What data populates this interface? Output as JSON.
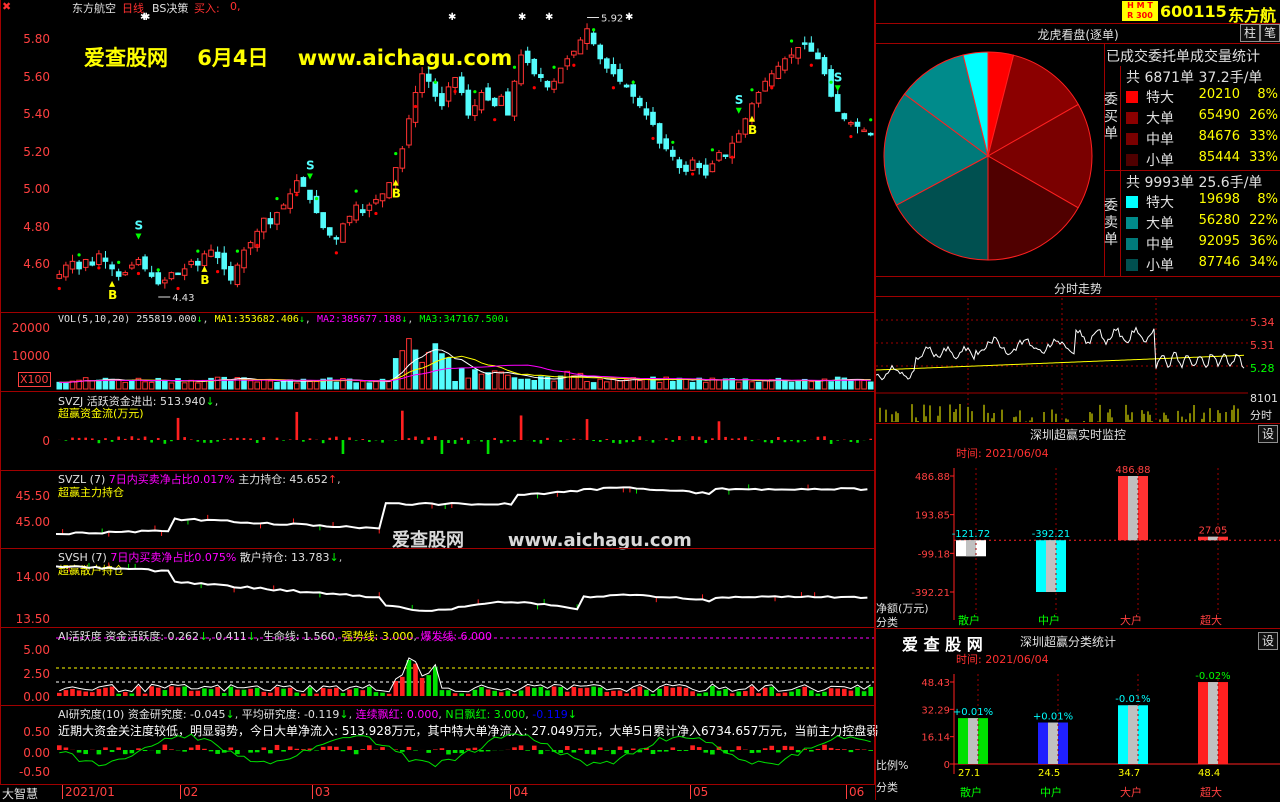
{
  "header": {
    "stock_name": "东方航空",
    "period": "日线",
    "indicator": "BS决策",
    "signal_label": "买入:",
    "signal_value": "0,",
    "hmt": "H M T",
    "r300": "R 300",
    "code": "600115",
    "name_short": "东方航",
    "btn_zhu": "柱",
    "btn_bi": "笔"
  },
  "watermark": {
    "line1": "爱查股网    6月4日    www.aichagu.com",
    "line2": "爱查股网       www.aichagu.com"
  },
  "main_chart": {
    "y_ticks": [
      "5.80",
      "5.60",
      "5.40",
      "5.20",
      "5.00",
      "4.80",
      "4.60"
    ],
    "y_values": [
      5.8,
      5.6,
      5.4,
      5.2,
      5.0,
      4.8,
      4.6
    ],
    "y_range": [
      4.35,
      5.96
    ],
    "high_label": "5.92",
    "low_label": "4.43",
    "closes": [
      4.55,
      4.6,
      4.62,
      4.58,
      4.63,
      4.6,
      4.66,
      4.62,
      4.58,
      4.54,
      4.56,
      4.6,
      4.63,
      4.58,
      4.54,
      4.5,
      4.52,
      4.56,
      4.55,
      4.58,
      4.62,
      4.6,
      4.66,
      4.68,
      4.64,
      4.58,
      4.52,
      4.6,
      4.68,
      4.72,
      4.78,
      4.85,
      4.82,
      4.88,
      4.92,
      4.98,
      5.05,
      5.02,
      4.95,
      4.88,
      4.8,
      4.76,
      4.74,
      4.82,
      4.86,
      4.92,
      4.88,
      4.92,
      4.95,
      4.98,
      5.04,
      5.12,
      5.22,
      5.38,
      5.52,
      5.62,
      5.58,
      5.5,
      5.45,
      5.55,
      5.6,
      5.52,
      5.4,
      5.45,
      5.52,
      5.48,
      5.45,
      5.5,
      5.4,
      5.58,
      5.72,
      5.68,
      5.62,
      5.6,
      5.55,
      5.58,
      5.65,
      5.7,
      5.74,
      5.8,
      5.86,
      5.78,
      5.7,
      5.65,
      5.62,
      5.58,
      5.55,
      5.5,
      5.45,
      5.4,
      5.35,
      5.25,
      5.22,
      5.18,
      5.12,
      5.1,
      5.16,
      5.12,
      5.08,
      5.14,
      5.2,
      5.18,
      5.25,
      5.3,
      5.38,
      5.46,
      5.52,
      5.58,
      5.62,
      5.66,
      5.7,
      5.72,
      5.76,
      5.78,
      5.74,
      5.7,
      5.62,
      5.5,
      5.42,
      5.38,
      5.36,
      5.34,
      5.32,
      5.3
    ],
    "b_signals": [
      "B",
      "B",
      "B",
      "B"
    ],
    "s_signals": [
      "S",
      "S",
      "S",
      "S"
    ],
    "b_index": [
      8,
      22,
      51,
      105
    ],
    "s_index": [
      12,
      38,
      103,
      118
    ]
  },
  "vol_panel": {
    "title": "VOL(5,10,20)",
    "v0": "255819.000",
    "ma1_label": "MA1:",
    "ma1": "353682.406",
    "ma2_label": "MA2:",
    "ma2": "385677.188",
    "ma3_label": "MA3:",
    "ma3": "347167.500",
    "y_ticks": [
      "20000",
      "10000"
    ],
    "unit": "X100"
  },
  "svzj_panel": {
    "title": "SVZJ",
    "line1": "活跃资金进出: 513.940",
    "line2": "超赢资金流(万元)",
    "y_tick": "0"
  },
  "svzl_panel": {
    "title": "SVZL (7)",
    "ratio_label": "7日内买卖净占比0.017%",
    "main_hold": "主力持仓: 45.652",
    "line2": "超赢主力持仓",
    "y_ticks": [
      "45.50",
      "45.00"
    ]
  },
  "svsh_panel": {
    "title": "SVSH (7)",
    "ratio_label": "7日内买卖净占比0.075%",
    "retail_hold": "散户持仓: 13.783",
    "line2": "超赢散户持仓",
    "y_ticks": [
      "14.00",
      "13.50"
    ]
  },
  "ai_active_panel": {
    "title": "AI活跃度",
    "active": "资金活跃度: 0.262",
    "v2": "0.411",
    "life": "生命线: 1.560",
    "strong": "强势线: 3.000",
    "burst": "爆发线: 6.000",
    "y_ticks": [
      "5.00",
      "2.50",
      "0.00"
    ]
  },
  "ai_research_panel": {
    "title": "AI研究度(10)",
    "research": "资金研究度: -0.045",
    "avg": "平均研究度: -0.119",
    "red": "连续飘红: 0.000",
    "nred": "N日飘红: 3.000",
    "neg": "-0.119",
    "comment": "近期大资金关注度较低，明显弱势，今日大单净流入: 513.928万元，其中特大单净流入: 27.049万元，大单5日累计净入6734.657万元，当前主力控盘弱",
    "y_ticks": [
      "0.50",
      "0.00",
      "-0.50"
    ]
  },
  "x_axis": {
    "labels": [
      "2021/01",
      "02",
      "03",
      "04",
      "05",
      "06"
    ],
    "footer_left": "大智慧"
  },
  "longhu": {
    "title": "龙虎看盘(逐单)",
    "subtitle": "已成交委托单成交量统计",
    "buy_side": "委买单",
    "sell_side": "委卖单",
    "buy_total": "共 6871单 37.2手/单",
    "sell_total": "共 9993单 25.6手/单",
    "buy_rows": [
      {
        "label": "特大",
        "value": "20210",
        "pct": "8%",
        "color": "#ff0000"
      },
      {
        "label": "大单",
        "value": "65490",
        "pct": "26%",
        "color": "#8b0000"
      },
      {
        "label": "中单",
        "value": "84676",
        "pct": "33%",
        "color": "#7a0000"
      },
      {
        "label": "小单",
        "value": "85444",
        "pct": "33%",
        "color": "#500000"
      }
    ],
    "sell_rows": [
      {
        "label": "特大",
        "value": "19698",
        "pct": "8%",
        "color": "#00ffff"
      },
      {
        "label": "大单",
        "value": "56280",
        "pct": "22%",
        "color": "#008b8b"
      },
      {
        "label": "中单",
        "value": "92095",
        "pct": "36%",
        "color": "#007a7a"
      },
      {
        "label": "小单",
        "value": "87746",
        "pct": "34%",
        "color": "#005050"
      }
    ]
  },
  "fenshi": {
    "title": "分时走势",
    "y_ticks": [
      "5.34",
      "5.31",
      "5.28"
    ],
    "vol_label": "8101",
    "vol_unit": "分时"
  },
  "monitor": {
    "title": "深圳超赢实时监控",
    "set_btn": "设",
    "time": "时间: 2021/06/04",
    "y_ticks": [
      "486.88",
      "193.85",
      "-99.18",
      "-392.21"
    ],
    "unit": "净额(万元)",
    "category_label": "分类",
    "categories": [
      "散户",
      "中户",
      "大户",
      "超大"
    ],
    "values": [
      -121.72,
      -392.21,
      486.88,
      27.05
    ],
    "value_labels": [
      "-121.72",
      "-392.21",
      "486.88",
      "27.05"
    ]
  },
  "classify": {
    "brand": "爱 查 股 网",
    "title": "深圳超赢分类统计",
    "set_btn": "设",
    "time": "时间: 2021/06/04",
    "y_ticks": [
      "48.43",
      "32.29",
      "16.14",
      "0"
    ],
    "ratio_label": "比例%",
    "category_label": "分类",
    "categories": [
      "散户",
      "中户",
      "大户",
      "超大"
    ],
    "values": [
      27.1,
      24.5,
      34.7,
      48.4
    ],
    "value_labels": [
      "27.1",
      "24.5",
      "34.7",
      "48.4"
    ],
    "delta_labels": [
      "+0.01%",
      "+0.01%",
      "-0.01%",
      "-0.02%"
    ]
  },
  "chart_data": [
    {
      "type": "bar",
      "title": "深圳超赢实时监控",
      "categories": [
        "散户",
        "中户",
        "大户",
        "超大"
      ],
      "values": [
        -121.72,
        -392.21,
        486.88,
        27.05
      ],
      "ylabel": "净额(万元)",
      "ylim": [
        -392.21,
        486.88
      ]
    },
    {
      "type": "bar",
      "title": "深圳超赢分类统计",
      "categories": [
        "散户",
        "中户",
        "大户",
        "超大"
      ],
      "values": [
        27.1,
        24.5,
        34.7,
        48.4
      ],
      "ylabel": "比例%",
      "ylim": [
        0,
        48.43
      ]
    },
    {
      "type": "pie",
      "title": "龙虎看盘(逐单)",
      "categories": [
        "买特大",
        "买大单",
        "买中单",
        "买小单",
        "卖特大",
        "卖大单",
        "卖中单",
        "卖小单"
      ],
      "values": [
        20210,
        65490,
        84676,
        85444,
        19698,
        56280,
        92095,
        87746
      ]
    }
  ]
}
